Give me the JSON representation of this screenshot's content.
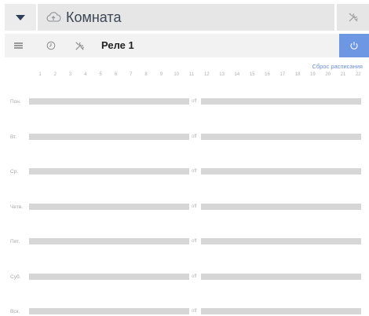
{
  "header": {
    "title": "Комната",
    "cloud_icon": "cloud-upload-icon",
    "tools_icon": "tools-icon",
    "dropdown_icon": "triangle-down-icon"
  },
  "subbar": {
    "menu_icon": "hamburger-icon",
    "clock_icon": "clock-icon",
    "tools_icon": "tools-icon",
    "relay_name": "Реле 1",
    "power_icon": "power-icon",
    "power_color": "#6d97e3"
  },
  "schedule": {
    "reset_label": "Сброс расписания",
    "hours": [
      "1",
      "2",
      "3",
      "4",
      "5",
      "6",
      "7",
      "8",
      "9",
      "10",
      "11",
      "12",
      "13",
      "14",
      "15",
      "16",
      "17",
      "18",
      "19",
      "20",
      "21",
      "22",
      "23"
    ],
    "off_label": "off",
    "days": [
      "Пон.",
      "Вт.",
      "Ср.",
      "Четв.",
      "Пят.",
      "Суб.",
      "Вск."
    ]
  }
}
